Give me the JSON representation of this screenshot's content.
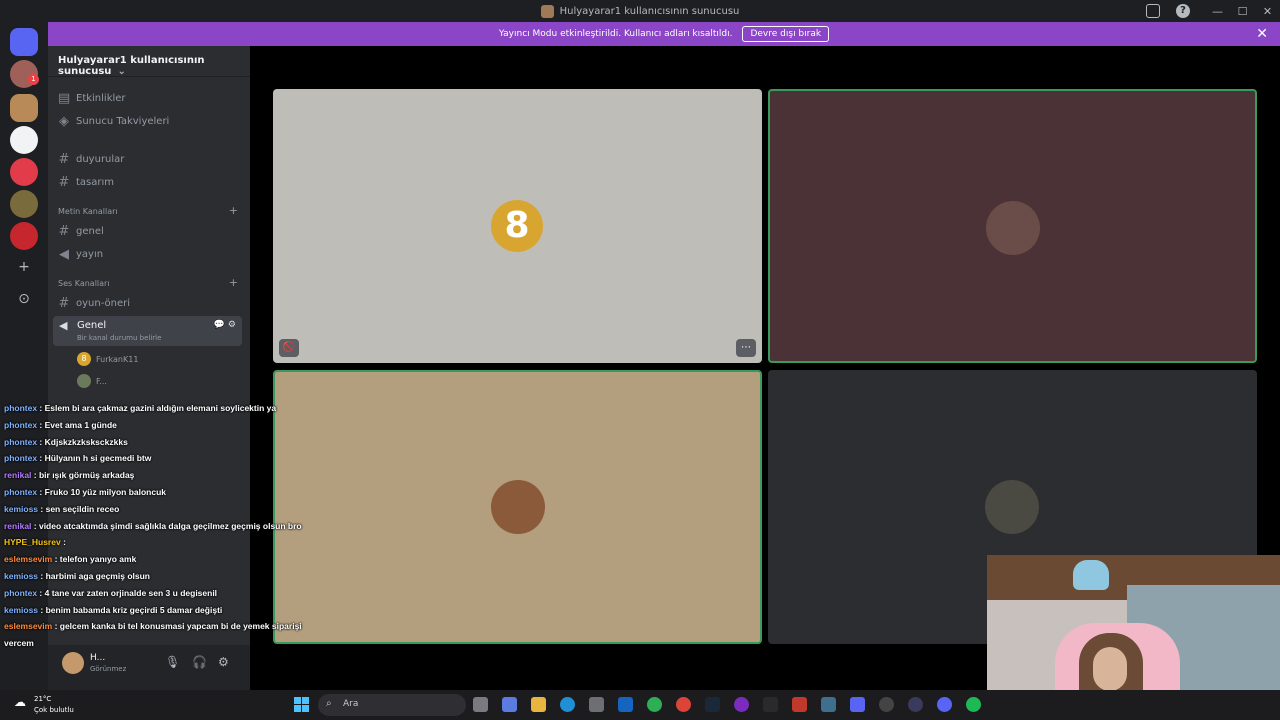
{
  "window": {
    "title": "Hulyayarar1 kullanıcısının sunucusu",
    "controls": {
      "minimize": "—",
      "maximize": "☐",
      "close": "✕"
    },
    "help": "?"
  },
  "banner": {
    "text": "Yayıncı Modu etkinleştirildi. Kullanıcı adları kısaltıldı.",
    "button": "Devre dışı bırak",
    "close": "✕"
  },
  "rail": {
    "badge1": "1",
    "add": "+",
    "explore": "⊙"
  },
  "sidebar": {
    "server_name": "Hulyayarar1 kullanıcısının sunucusu",
    "chevron": "⌄",
    "top_items": [
      "Etkinlikler",
      "Sunucu Takviyeleri"
    ],
    "channels": [
      "duyurular",
      "tasarım"
    ],
    "text_category": "Metin Kanalları",
    "text_channels": [
      "genel",
      "yayın"
    ],
    "voice_category": "Ses Kanalları",
    "voice_channels": [
      "oyun-öneri"
    ],
    "active_voice": {
      "name": "Genel",
      "status": "Bir kanal durumu belirle",
      "icons": "💬 ⚙"
    },
    "voice_users": [
      {
        "initial": "8",
        "name": "FurkanK11"
      },
      {
        "initial": "",
        "name": "F..."
      }
    ],
    "plus": "+"
  },
  "user_panel": {
    "name": "H...",
    "status": "Görünmez",
    "mic": "🎙",
    "headset": "🎧",
    "settings": "⚙"
  },
  "stage": {
    "tile1_initial": "8",
    "tile_menu": "⋯",
    "tile_mute": "🚫"
  },
  "chat": [
    {
      "user": "phontex",
      "color": "#7fb3ff",
      "text": "Eslem bi ara çakmaz gazini aldığın elemani soylicektin ya"
    },
    {
      "user": "phontex",
      "color": "#7fb3ff",
      "text": "Evet ama 1 günde"
    },
    {
      "user": "phontex",
      "color": "#7fb3ff",
      "text": "Kdjskzkzksksckzkks"
    },
    {
      "user": "phontex",
      "color": "#7fb3ff",
      "text": "Hülyanın h si gecmedi btw"
    },
    {
      "user": "renikal",
      "color": "#b57bff",
      "text": "bir ışık görmüş arkadaş"
    },
    {
      "user": "phontex",
      "color": "#7fb3ff",
      "text": "Fruko 10 yüz milyon baloncuk"
    },
    {
      "user": "kemioss",
      "color": "#7fb3ff",
      "text": "sen seçildin receo"
    },
    {
      "user": "renikal",
      "color": "#b57bff",
      "text": "video atcaktımda şimdi sağlıkla dalga geçilmez geçmiş olsun bro"
    },
    {
      "user": "HYPE_Husrev",
      "color": "#f5c518",
      "text": ""
    },
    {
      "user": "eslemsevim",
      "color": "#ff8a3d",
      "text": "telefon yanıyo amk"
    },
    {
      "user": "kemioss",
      "color": "#7fb3ff",
      "text": "harbimi aga geçmiş olsun"
    },
    {
      "user": "phontex",
      "color": "#7fb3ff",
      "text": "4 tane var zaten orjinalde sen 3 u degisenil"
    },
    {
      "user": "kemioss",
      "color": "#7fb3ff",
      "text": "benim babamda kriz geçirdi 5 damar değişti"
    },
    {
      "user": "eslemsevim",
      "color": "#ff8a3d",
      "text": "gelcem kanka bi tel konusmasi yapcam bi de yemek siparişi"
    },
    {
      "user": "",
      "color": "#ffffff",
      "text": "vercem"
    }
  ],
  "taskbar": {
    "temp": "21°C",
    "weather": "Çok bulutlu",
    "search": "Ara"
  }
}
